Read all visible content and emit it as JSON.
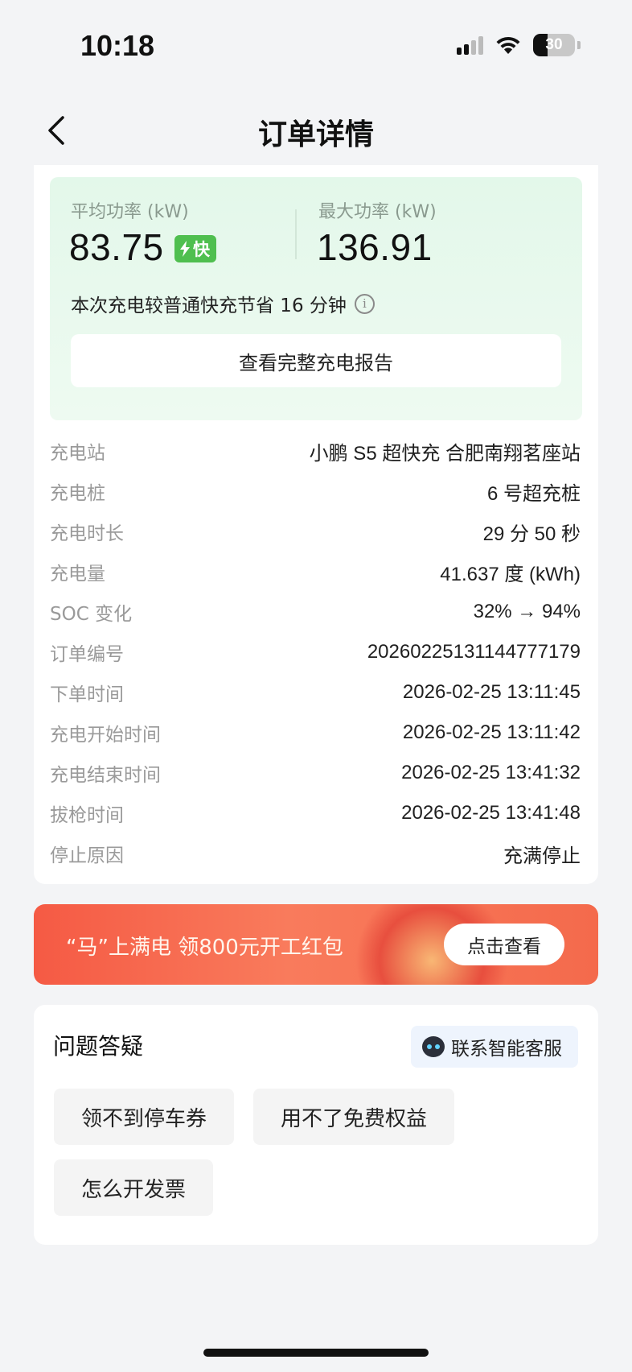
{
  "status_bar": {
    "time": "10:18",
    "battery": "30"
  },
  "header": {
    "title": "订单详情"
  },
  "power": {
    "avg_label": "平均功率 (kW)",
    "avg_value": "83.75",
    "fast_badge": "快",
    "max_label": "最大功率 (kW)",
    "max_value": "136.91",
    "saving_note": "本次充电较普通快充节省 16 分钟",
    "report_button": "查看完整充电报告"
  },
  "details": [
    {
      "label": "充电站",
      "value": "小鹏 S5 超快充 合肥南翔茗座站"
    },
    {
      "label": "充电桩",
      "value": "6 号超充桩"
    },
    {
      "label": "充电时长",
      "value": "29 分 50 秒"
    },
    {
      "label": "充电量",
      "value": "41.637 度 (kWh)"
    },
    {
      "label": "SOC 变化",
      "value": "32% → 94%"
    },
    {
      "label": "订单编号",
      "value": "20260225131144777179"
    },
    {
      "label": "下单时间",
      "value": "2026-02-25 13:11:45"
    },
    {
      "label": "充电开始时间",
      "value": "2026-02-25 13:11:42"
    },
    {
      "label": "充电结束时间",
      "value": "2026-02-25 13:41:32"
    },
    {
      "label": "拔枪时间",
      "value": "2026-02-25 13:41:48"
    },
    {
      "label": "停止原因",
      "value": "充满停止"
    }
  ],
  "promo": {
    "text": "“马”上满电 领800元开工红包",
    "button": "点击查看"
  },
  "faq": {
    "title": "问题答疑",
    "support_button": "联系智能客服",
    "chips": [
      "领不到停车券",
      "用不了免费权益",
      "怎么开发票"
    ]
  }
}
